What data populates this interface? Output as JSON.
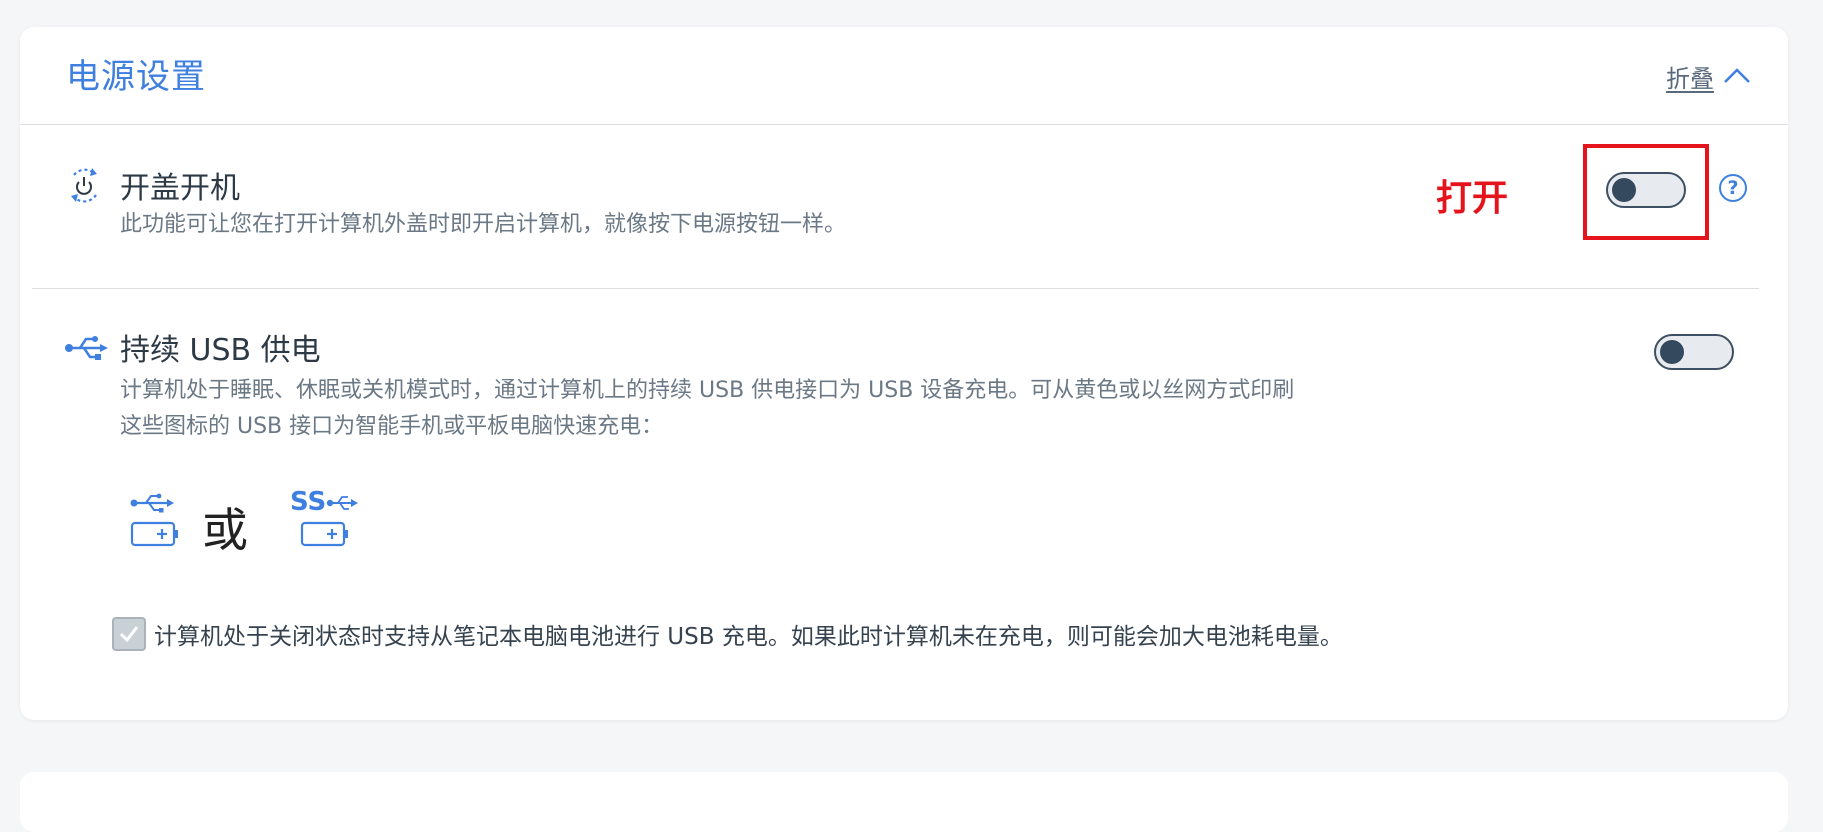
{
  "header": {
    "title": "电源设置",
    "collapse_label": "折叠"
  },
  "settings": [
    {
      "title": "开盖开机",
      "description": "此功能可让您在打开计算机外盖时即开启计算机，就像按下电源按钮一样。",
      "enabled": false,
      "annotation": "打开",
      "help_icon": "?"
    },
    {
      "title": "持续 USB 供电",
      "description_line1": "计算机处于睡眠、休眠或关机模式时，通过计算机上的持续 USB 供电接口为 USB 设备充电。可从黄色或以丝网方式印刷",
      "description_line2": "这些图标的 USB 接口为智能手机或平板电脑快速充电：",
      "enabled": false,
      "or_label": "或",
      "ss_label": "SS",
      "checkbox_label": "计算机处于关闭状态时支持从笔记本电脑电池进行 USB 充电。如果此时计算机未在充电，则可能会加大电池耗电量。",
      "checkbox_checked": true
    }
  ],
  "colors": {
    "accent": "#3f7fe0",
    "annotation": "#e5141c",
    "toggle_knob": "#34495e"
  }
}
